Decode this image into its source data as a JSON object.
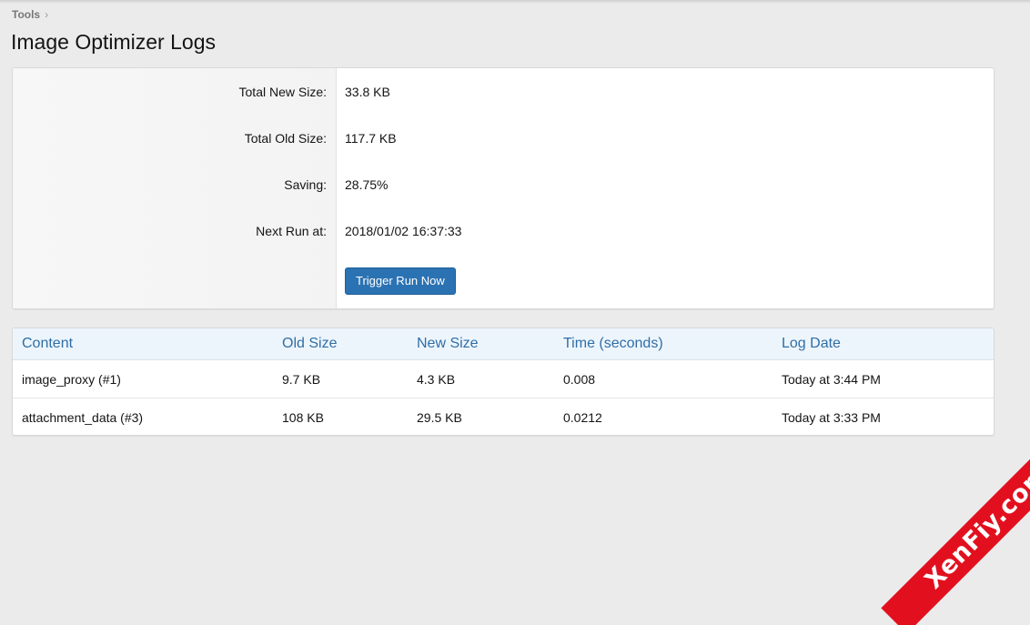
{
  "breadcrumb": {
    "item": "Tools",
    "separator": "›"
  },
  "page_title": "Image Optimizer Logs",
  "summary": {
    "total_new_size_label": "Total New Size:",
    "total_new_size_value": "33.8 KB",
    "total_old_size_label": "Total Old Size:",
    "total_old_size_value": "117.7 KB",
    "saving_label": "Saving:",
    "saving_value": "28.75%",
    "next_run_label": "Next Run at:",
    "next_run_value": "2018/01/02 16:37:33",
    "trigger_button": "Trigger Run Now"
  },
  "table": {
    "headers": [
      "Content",
      "Old Size",
      "New Size",
      "Time (seconds)",
      "Log Date"
    ],
    "rows": [
      [
        "image_proxy (#1)",
        "9.7 KB",
        "4.3 KB",
        "0.008",
        "Today at 3:44 PM"
      ],
      [
        "attachment_data (#3)",
        "108 KB",
        "29.5 KB",
        "0.0212",
        "Today at 3:33 PM"
      ]
    ]
  },
  "watermark": "XenFiy.com",
  "colors": {
    "accent": "#2b72b3",
    "header_text": "#2f6ea6",
    "watermark_bg": "#e2101e"
  }
}
